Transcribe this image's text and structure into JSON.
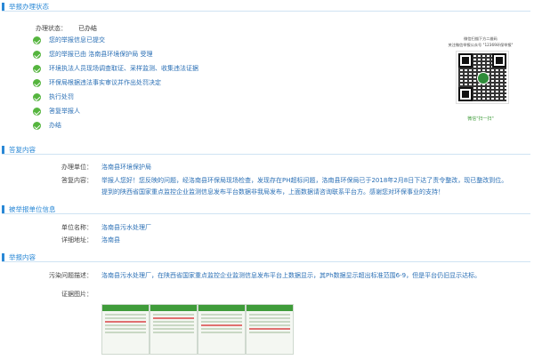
{
  "section1": {
    "title": "举报办理状态",
    "status_label": "办理状态：",
    "status_value": "已办结",
    "steps": [
      "您的举报信息已提交",
      "您的举报已由 洛南县环境保护局 受理",
      "环境执法人员现场调查取证、采样监测、收集违法证据",
      "环保局根据违法事实审议并作出处罚决定",
      "执行处罚",
      "答复举报人",
      "办结"
    ],
    "qr": {
      "caption_line1": "微信扫描下方二维码",
      "caption_line2": "关注微信举报公众号 \"12369环保举报\"",
      "scan_label": "微信\"扫一扫\""
    }
  },
  "section2": {
    "title": "答复内容",
    "unit_label": "办理单位：",
    "unit_value": "洛南县环境保护局",
    "reply_label": "答复内容：",
    "reply_text": "举报人您好！您反映的问题，经洛南县环保局现场检查，发现存在PH超标问题，洛南县环保局已于2018年2月8日下达了责令整改，现已整改到位。提到的陕西省国家重点监控企业监测信息发布平台数据非我局发布，上面数据请咨询联系平台方。感谢您对环保事业的支持！"
  },
  "section3": {
    "title": "被举报单位信息",
    "name_label": "单位名称：",
    "name_value": "洛南县污水处理厂",
    "address_label": "详细地址：",
    "address_value": "洛南县"
  },
  "section4": {
    "title": "举报内容",
    "desc_label": "污染问题描述：",
    "desc_value": "洛南县污水处理厂，在陕西省国家重点监控企业监测信息发布平台上数据显示，其Ph数据显示超出标准范围6-9，但是平台仍旧显示达标。",
    "evidence_label": "证据图片："
  },
  "colors": {
    "accent": "#2a88d6",
    "success": "#55b53e",
    "value_text": "#2a6fb5"
  }
}
